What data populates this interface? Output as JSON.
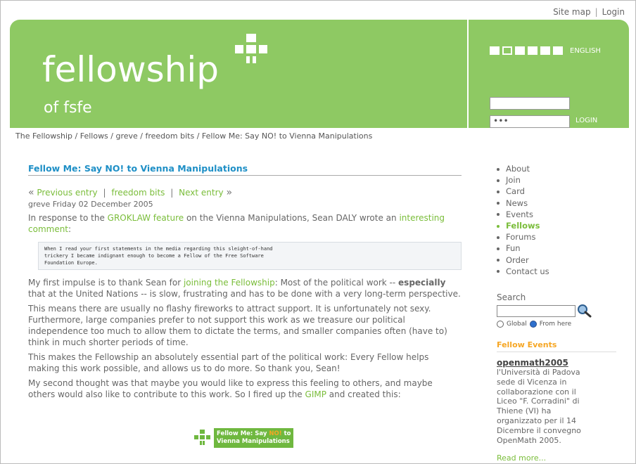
{
  "toplinks": {
    "sitemap": "Site map",
    "sep": "|",
    "login": "Login"
  },
  "logo": {
    "main": "fellowship",
    "sub": "of fsfe"
  },
  "lang": {
    "label": "ENGLISH"
  },
  "login_form": {
    "user_value": "",
    "password_value": "•••",
    "button": "LOGIN"
  },
  "breadcrumb": "The Fellowship / Fellows / greve / freedom bits / Fellow Me: Say NO! to Vienna Manipulations",
  "post": {
    "title": "Fellow Me: Say NO! to Vienna Manipulations",
    "nav": {
      "prev_arrow": "«",
      "prev": "Previous entry",
      "sep1": "|",
      "middle": "freedom bits",
      "sep2": "|",
      "next": "Next entry",
      "next_arrow": "»"
    },
    "meta": "greve  Friday 02 December 2005",
    "p1_a": "In response to the ",
    "p1_link1": "GROKLAW feature",
    "p1_b": " on the Vienna Manipulations, Sean DALY wrote an ",
    "p1_link2": "interesting comment",
    "p1_c": ":",
    "quote": "When I read your first statements in the media regarding this sleight-of-hand\ntrickery I became indignant enough to become a Fellow of the Free Software\nFoundation Europe.",
    "p2_a": "My first impulse is to thank Sean for ",
    "p2_link": "joining the Fellowship",
    "p2_b": ": Most of the political work -- ",
    "p2_bold": "especially",
    "p2_c": " that at the United Nations -- is slow, frustrating and has to be done with a very long-term perspective.",
    "p3": "This means there are usually no flashy fireworks to attract support. It is unfortunately not sexy. Furthermore, large companies prefer to not support this work as we treasure our political independence too much to allow them to dictate the terms, and smaller companies often (have to) think in much shorter periods of time.",
    "p4": "This makes the Fellowship an absolutely essential part of the political work: Every Fellow helps making this work possible, and allows us to do more. So thank you, Sean!",
    "p5_a": "My second thought was that maybe you would like to express this feeling to others, and maybe others would also like to contribute to this work. So I fired up the ",
    "p5_link": "GIMP",
    "p5_b": " and created this:",
    "banner": {
      "line1_a": "Fellow Me: Say ",
      "line1_hl": "NO!",
      "line1_b": " to",
      "line2": "Vienna Manipulations"
    }
  },
  "sidebar": {
    "nav": [
      "About",
      "Join",
      "Card",
      "News",
      "Events",
      "Fellows",
      "Forums",
      "Fun",
      "Order",
      "Contact us"
    ],
    "active": "Fellows",
    "search": {
      "heading": "Search",
      "value": "",
      "opt_global": "Global",
      "opt_here": "From here",
      "selected": "From here"
    },
    "events": {
      "heading": "Fellow Events",
      "title": "openmath2005",
      "body": "l'Università di Padova sede di Vicenza in collaborazione con il Liceo \"F. Corradini\" di Thiene (VI) ha organizzato per il 14 Dicembre il convegno OpenMath 2005.",
      "more": "Read more..."
    }
  },
  "colors": {
    "header_green": "#8ec963",
    "link_green": "#7abd3a",
    "title_blue": "#1e8fc6",
    "events_orange": "#f6a623"
  }
}
